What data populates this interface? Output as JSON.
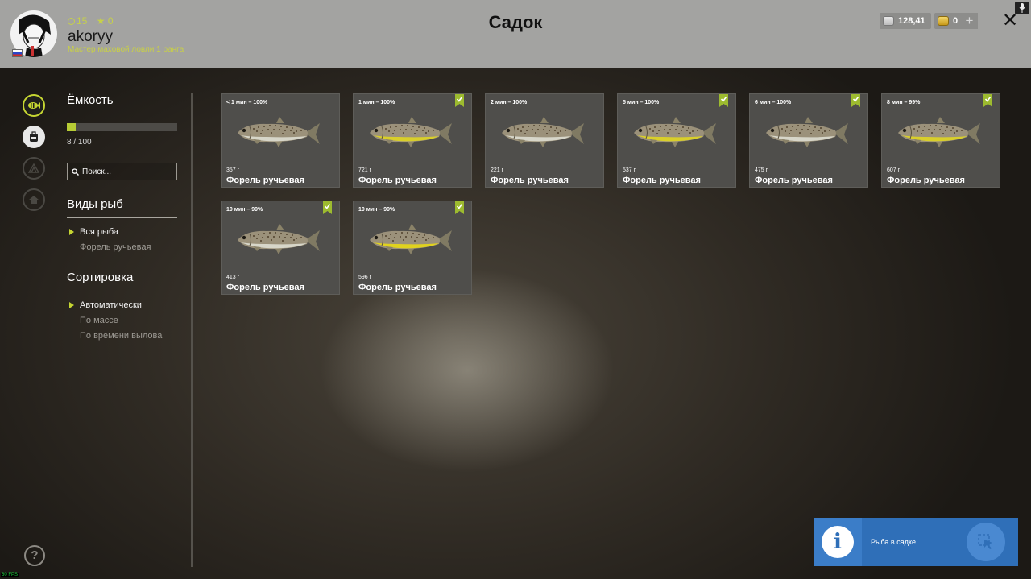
{
  "header": {
    "title": "Садок",
    "player": {
      "username": "akoryy",
      "level": "15",
      "stars": "0",
      "rank": "Мастер маховой ловли 1 ранга"
    },
    "silver": "128,41",
    "gold": "0",
    "plus_label": "+",
    "close_label": "✕"
  },
  "sidebar": {
    "capacity_title": "Ёмкость",
    "capacity_text": "8 / 100",
    "capacity_fraction": 0.08,
    "search_placeholder": "Поиск...",
    "species_title": "Виды рыб",
    "species": [
      {
        "label": "Вся рыба",
        "selected": true
      },
      {
        "label": "Форель ручьевая",
        "selected": false
      }
    ],
    "sort_title": "Сортировка",
    "sort_options": [
      {
        "label": "Автоматически",
        "selected": true
      },
      {
        "label": "По массе",
        "selected": false
      },
      {
        "label": "По времени вылова",
        "selected": false
      }
    ],
    "help_label": "?"
  },
  "fish": [
    {
      "time": "< 1 мин – 100%",
      "weight": "357 г",
      "name": "Форель ручьевая",
      "trophy": false,
      "belly": "#d7d6c9"
    },
    {
      "time": "1 мин – 100%",
      "weight": "721 г",
      "name": "Форель ручьевая",
      "trophy": true,
      "belly": "#d9cf2a"
    },
    {
      "time": "2 мин – 100%",
      "weight": "221 г",
      "name": "Форель ручьевая",
      "trophy": false,
      "belly": "#d7d6c9"
    },
    {
      "time": "5 мин – 100%",
      "weight": "537 г",
      "name": "Форель ручьевая",
      "trophy": true,
      "belly": "#d9cf2a"
    },
    {
      "time": "6 мин – 100%",
      "weight": "475 г",
      "name": "Форель ручьевая",
      "trophy": true,
      "belly": "#d7d6c9"
    },
    {
      "time": "8 мин – 99%",
      "weight": "607 г",
      "name": "Форель ручьевая",
      "trophy": true,
      "belly": "#d9cf2a"
    },
    {
      "time": "10 мин – 99%",
      "weight": "413 г",
      "name": "Форель ручьевая",
      "trophy": true,
      "belly": "#d7d6c9"
    },
    {
      "time": "10 мин – 99%",
      "weight": "596 г",
      "name": "Форель ручьевая",
      "trophy": true,
      "belly": "#e0d21e"
    }
  ],
  "notification": {
    "text": "Рыба в садке"
  },
  "fps": "60 FPS",
  "colors": {
    "accent": "#c5d532",
    "card_bg": "#4f4e4b",
    "header_bg": "#a3a3a1",
    "toast_bg": "#2f6fb8"
  }
}
